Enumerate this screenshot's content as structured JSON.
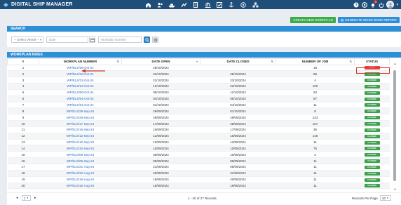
{
  "app": {
    "title": "DIGITAL SHIP MANAGER",
    "notification_count": "1"
  },
  "nav": {
    "icons": [
      "home-icon",
      "users-icon",
      "ship-icon",
      "graph-icon",
      "document-icon",
      "bank-icon",
      "checklist-icon",
      "anchor-icon",
      "compass-icon",
      "network-icon"
    ]
  },
  "actions": {
    "create": "CREATE NEW WORKPLAN",
    "report": "GENERATE WORK DONE REPORT"
  },
  "search": {
    "header": "SEARCH",
    "vessel_placeholder": "-- Select Vessel --",
    "date_placeholder": "Date",
    "workplan_placeholder": "Workplan Number"
  },
  "index": {
    "header": "WORKPLAN INDEX",
    "columns": [
      "#",
      "WORKPLAN NUMBER",
      "DATE OPEN",
      "DATE CLOSED",
      "NUMBER OF JOB",
      "STATUS"
    ],
    "rows": [
      [
        "1",
        "WP/ELS/28-Oct-24",
        "28/10/2024",
        "",
        "18",
        "OPEN"
      ],
      [
        "2",
        "WP/ELS/23-Oct-24",
        "23/10/2024",
        "28/10/2024",
        "89",
        "CLOSED"
      ],
      [
        "3",
        "WP/ELS/22-Oct-24",
        "22/10/2024",
        "23/10/2024",
        "4",
        "CLOSED"
      ],
      [
        "4",
        "WP/ELS/12-Oct-24",
        "12/10/2024",
        "22/10/2024",
        "100",
        "CLOSED"
      ],
      [
        "5",
        "WP/ELS/09-Oct-24",
        "09/10/2024",
        "12/10/2024",
        "63",
        "CLOSED"
      ],
      [
        "6",
        "WP/ELS/04-Oct-24",
        "04/10/2024",
        "09/10/2024",
        "87",
        "CLOSED"
      ],
      [
        "7",
        "WP/ELS/01-Oct-24",
        "01/10/2024",
        "04/10/2024",
        "11",
        "CLOSED"
      ],
      [
        "8",
        "WP/ELS/29-Sep-24",
        "29/09/2024",
        "01/10/2024",
        "8",
        "CLOSED"
      ],
      [
        "9",
        "WP/ELS/28-Sep-24",
        "28/09/2024",
        "29/09/2024",
        "223",
        "CLOSED"
      ],
      [
        "10",
        "WP/ELS/17-Sep-24",
        "17/09/2024",
        "28/09/2024",
        "107",
        "CLOSED"
      ],
      [
        "11",
        "WP/ELS/16-Sep-24",
        "16/09/2024",
        "17/09/2024",
        "36",
        "CLOSED"
      ],
      [
        "12",
        "WP/ELS/12-Sep-24",
        "12/09/2024",
        "16/09/2024",
        "145",
        "CLOSED"
      ],
      [
        "13",
        "WP/ELS/10-Sep-24",
        "10/09/2024",
        "12/09/2024",
        "11",
        "CLOSED"
      ],
      [
        "14",
        "WP/ELS/10-Sep-24",
        "10/09/2024",
        "10/09/2024",
        "75",
        "CLOSED"
      ],
      [
        "15",
        "WP/ELS/09-Sep-24",
        "09/09/2024",
        "10/09/2024",
        "3",
        "CLOSED"
      ],
      [
        "16",
        "WP/ELS/05-Sep-24",
        "05/09/2024",
        "09/09/2024",
        "11",
        "CLOSED"
      ],
      [
        "17",
        "WP/ELS/21-Aug-24",
        "21/08/2024",
        "05/09/2024",
        "11",
        "CLOSED"
      ],
      [
        "18",
        "WP/ELS/20-Aug-24",
        "20/08/2024",
        "21/08/2024",
        "11",
        "CLOSED"
      ],
      [
        "19",
        "WP/ELS/19-Aug-24",
        "19/08/2024",
        "20/08/2024",
        "11",
        "CLOSED"
      ],
      [
        "20",
        "WP/ELS/16-Aug-24",
        "16/08/2024",
        "19/08/2024",
        "11",
        "CLOSED"
      ]
    ]
  },
  "footer": {
    "page": "1",
    "summary": "1 - 20 of 27 Records",
    "records_label": "Records Per Page",
    "records_value": "20"
  },
  "colors": {
    "header": "#1f4e79",
    "panel": "#2d8fd5",
    "open": "#e04545",
    "closed": "#3aa14a",
    "link": "#2a6cc3"
  }
}
